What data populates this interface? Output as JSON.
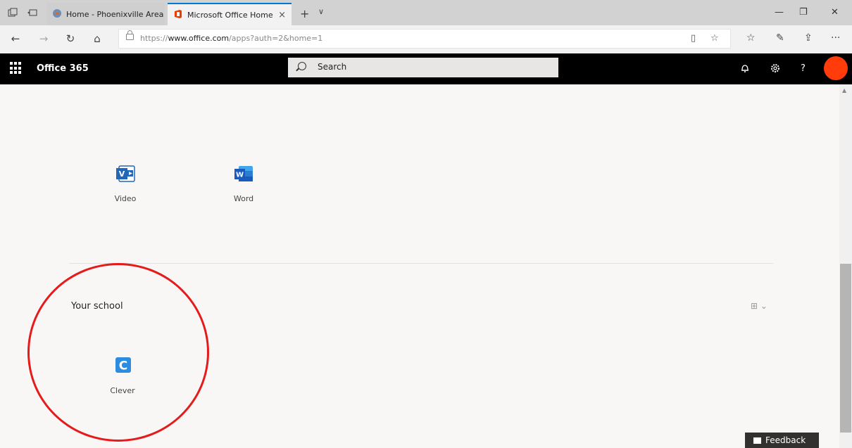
{
  "browser": {
    "tabs": [
      {
        "label": "Home - Phoenixville Area H",
        "active": false
      },
      {
        "label": "Microsoft Office Home",
        "active": true
      }
    ],
    "close_glyph": "×",
    "new_tab_glyph": "+",
    "tab_menu_glyph": "∨",
    "window_controls": {
      "minimize": "—",
      "maximize": "❐",
      "close": "✕"
    },
    "nav": {
      "back": "←",
      "forward": "→",
      "refresh": "↻",
      "home": "⌂"
    },
    "url": {
      "prefix": "https://",
      "host": "www.office.com",
      "path": "/apps?auth=2&home=1"
    },
    "reading_view_glyph": "▯",
    "favorite_glyph": "☆",
    "toolbar": {
      "favorites": "☆",
      "notes": "✎",
      "share": "⇪",
      "more": "···"
    }
  },
  "header": {
    "brand": "Office 365",
    "search_placeholder": "Search",
    "icons": {
      "bell": "♫",
      "settings": "⚙",
      "help": "?"
    },
    "avatar_color": "#ff3c0a"
  },
  "apps": [
    {
      "label": "Video",
      "icon": "video-icon",
      "color": "#2266b8",
      "glyph": "V"
    },
    {
      "label": "Word",
      "icon": "word-icon",
      "color": "#2b579a",
      "glyph": "W"
    }
  ],
  "school": {
    "title": "Your school",
    "view_toggle": "⊞ ⌄",
    "apps": [
      {
        "label": "Clever",
        "icon": "clever-icon",
        "color": "#2d8ce0",
        "glyph": "C"
      }
    ]
  },
  "feedback": {
    "label": "Feedback"
  },
  "annotation": {
    "color": "#e51b1b"
  }
}
